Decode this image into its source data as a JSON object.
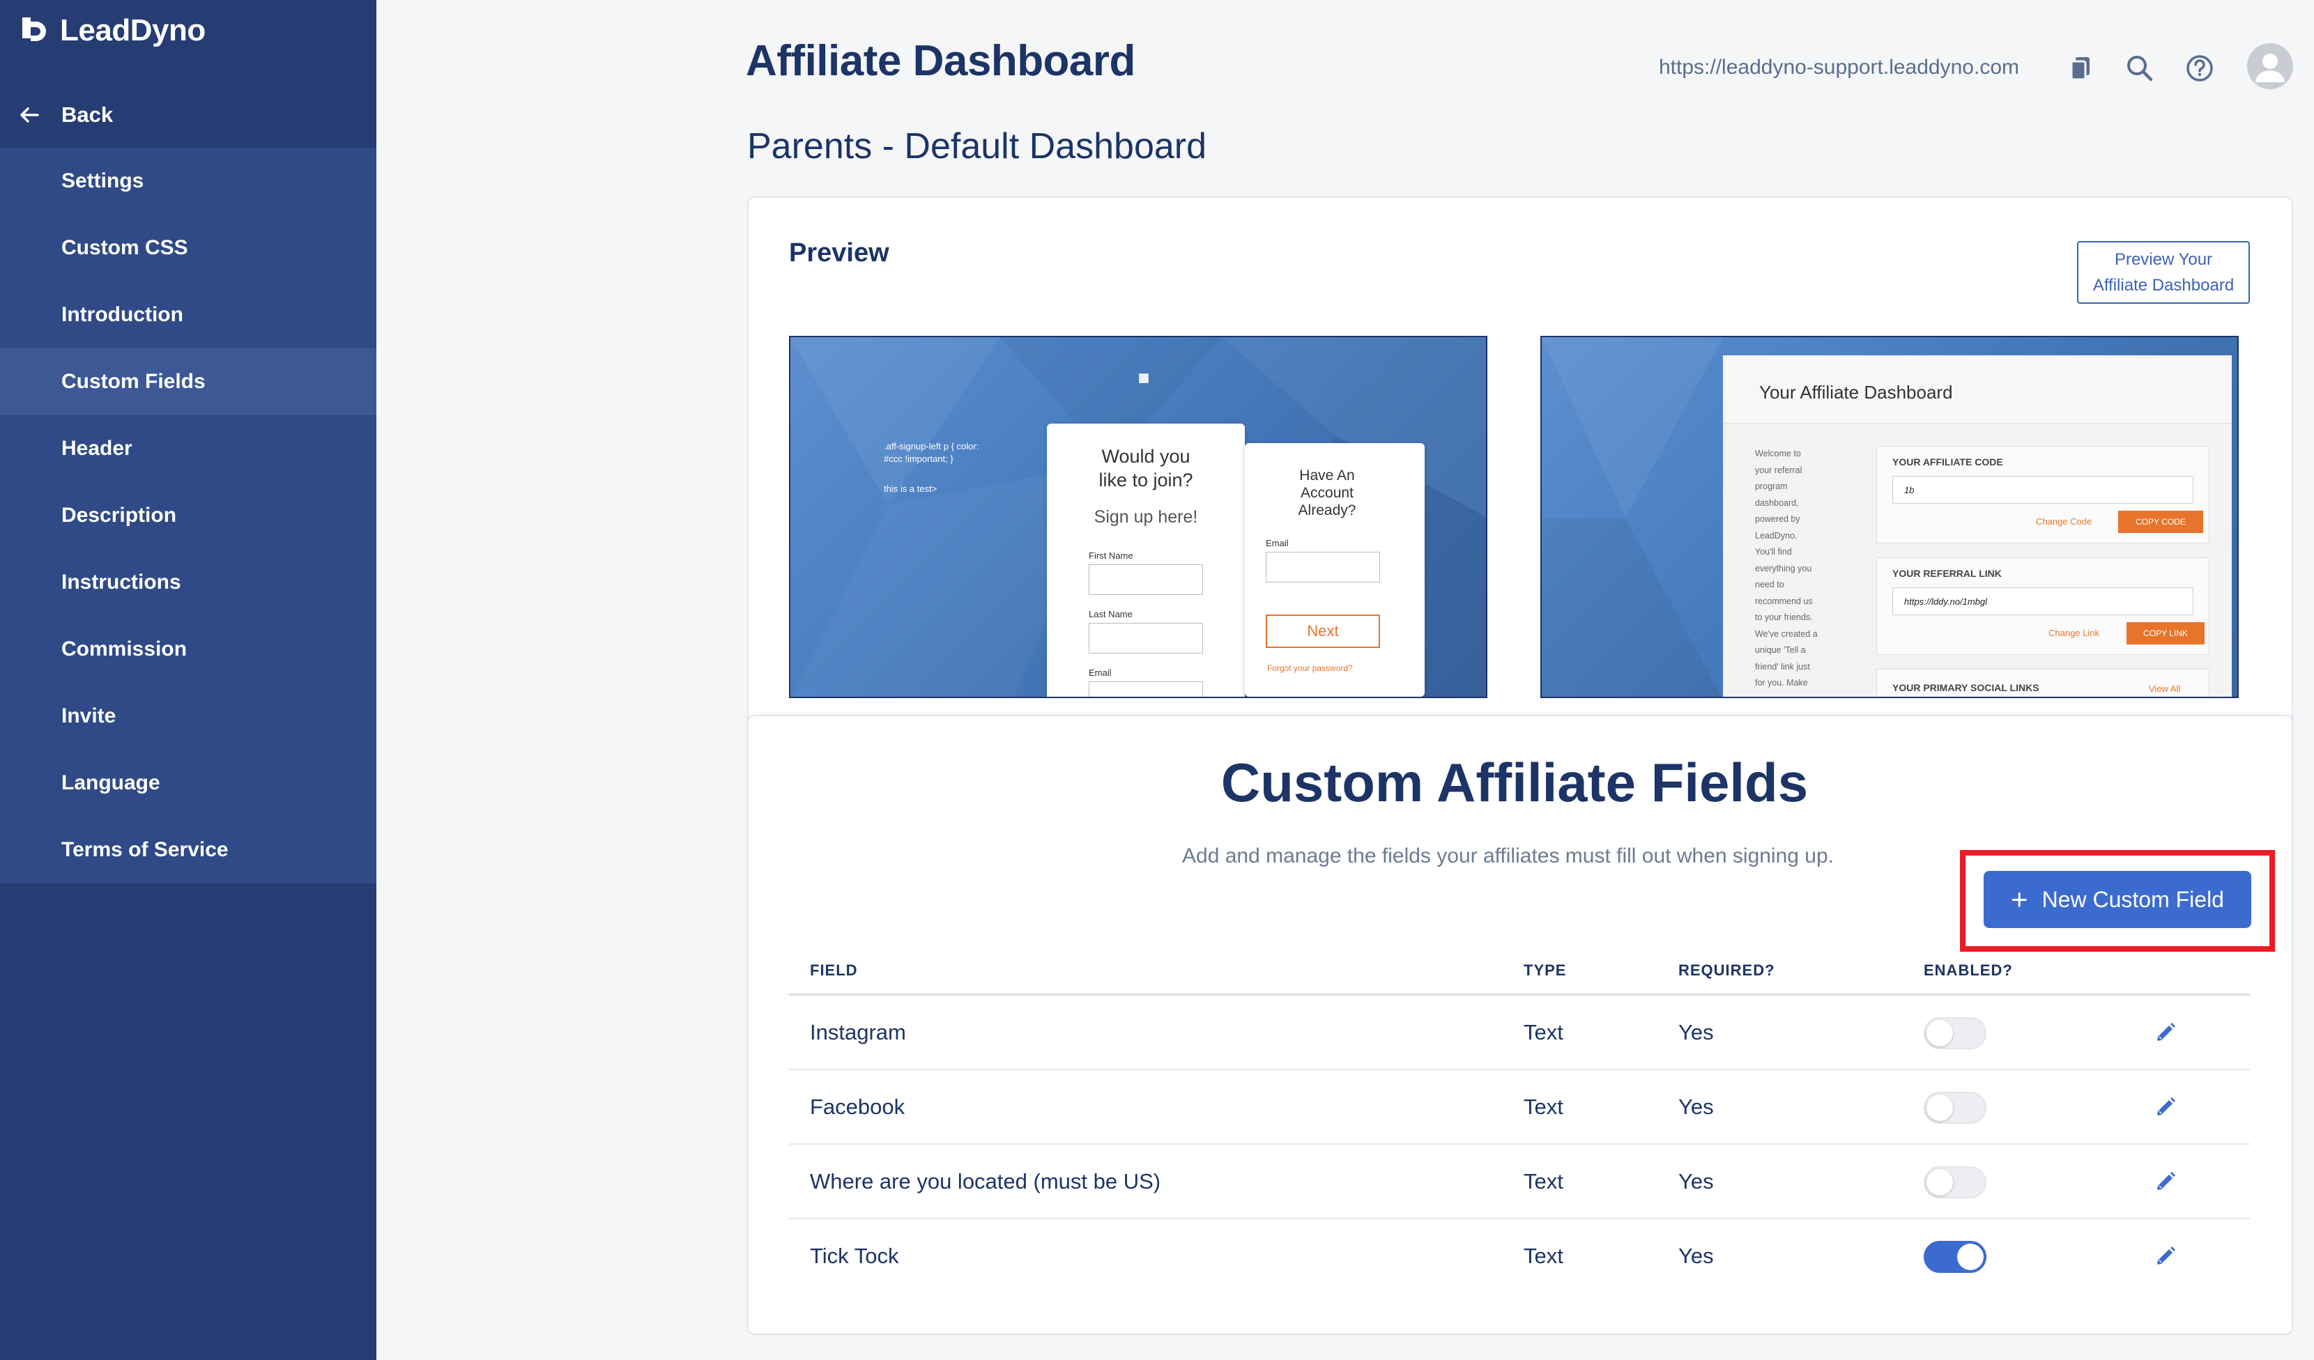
{
  "app": {
    "logo_text": "LeadDyno"
  },
  "sidebar": {
    "back_label": "Back",
    "items": [
      {
        "label": "Settings",
        "active": false
      },
      {
        "label": "Custom CSS",
        "active": false
      },
      {
        "label": "Introduction",
        "active": false
      },
      {
        "label": "Custom Fields",
        "active": true
      },
      {
        "label": "Header",
        "active": false
      },
      {
        "label": "Description",
        "active": false
      },
      {
        "label": "Instructions",
        "active": false
      },
      {
        "label": "Commission",
        "active": false
      },
      {
        "label": "Invite",
        "active": false
      },
      {
        "label": "Language",
        "active": false
      },
      {
        "label": "Terms of Service",
        "active": false
      }
    ]
  },
  "header": {
    "title": "Affiliate Dashboard",
    "subtitle": "Parents - Default Dashboard",
    "url": "https://leaddyno-support.leaddyno.com"
  },
  "preview": {
    "label": "Preview",
    "button_line1": "Preview Your",
    "button_line2": "Affiliate Dashboard",
    "signup": {
      "css_text": ".aff-signup-left p { color:\n#ccc !important; }",
      "test_text": "this is a test>",
      "join_title": "Would you\nlike to join?",
      "join_sub": "Sign up here!",
      "first_name": "First Name",
      "last_name": "Last Name",
      "email": "Email",
      "account_title": "Have An\nAccount\nAlready?",
      "account_email": "Email",
      "next": "Next",
      "forgot": "Forgot your password?"
    },
    "dashboard": {
      "title": "Your Affiliate Dashboard",
      "intro": "Welcome to\nyour referral\nprogram\ndashboard,\npowered by\nLeadDyno.\nYou'll find\neverything you\nneed to\nrecommend us\nto your friends.\nWe've created a\nunique 'Tell a\nfriend' link just\nfor you. Make",
      "code_label": "YOUR AFFILIATE CODE",
      "code_value": "1b",
      "change_code": "Change Code",
      "copy_code": "COPY CODE",
      "link_label": "YOUR REFERRAL LINK",
      "link_value": "https://lddy.no/1mbgl",
      "change_link": "Change Link",
      "copy_link": "COPY LINK",
      "social_label": "YOUR PRIMARY SOCIAL LINKS",
      "view_all": "View All"
    }
  },
  "fields_section": {
    "title": "Custom Affiliate Fields",
    "description": "Add and manage the fields your affiliates must fill out when signing up.",
    "new_button": "New Custom Field",
    "columns": {
      "field": "FIELD",
      "type": "TYPE",
      "required": "REQUIRED?",
      "enabled": "ENABLED?"
    },
    "rows": [
      {
        "field": "Instagram",
        "type": "Text",
        "required": "Yes",
        "enabled": false
      },
      {
        "field": "Facebook",
        "type": "Text",
        "required": "Yes",
        "enabled": false
      },
      {
        "field": "Where are you located (must be US)",
        "type": "Text",
        "required": "Yes",
        "enabled": false
      },
      {
        "field": "Tick Tock",
        "type": "Text",
        "required": "Yes",
        "enabled": true
      }
    ]
  },
  "colors": {
    "sidebar": "#263d73",
    "nav": "#2f4a86",
    "nav_active": "#3c5895",
    "accent": "#3c6bd0",
    "highlight": "#ec1c24",
    "orange": "#e8732a"
  },
  "icons": [
    "copy-icon",
    "search-icon",
    "help-icon",
    "avatar-icon",
    "back-arrow-icon",
    "plus-icon",
    "edit-pencil-icon"
  ]
}
